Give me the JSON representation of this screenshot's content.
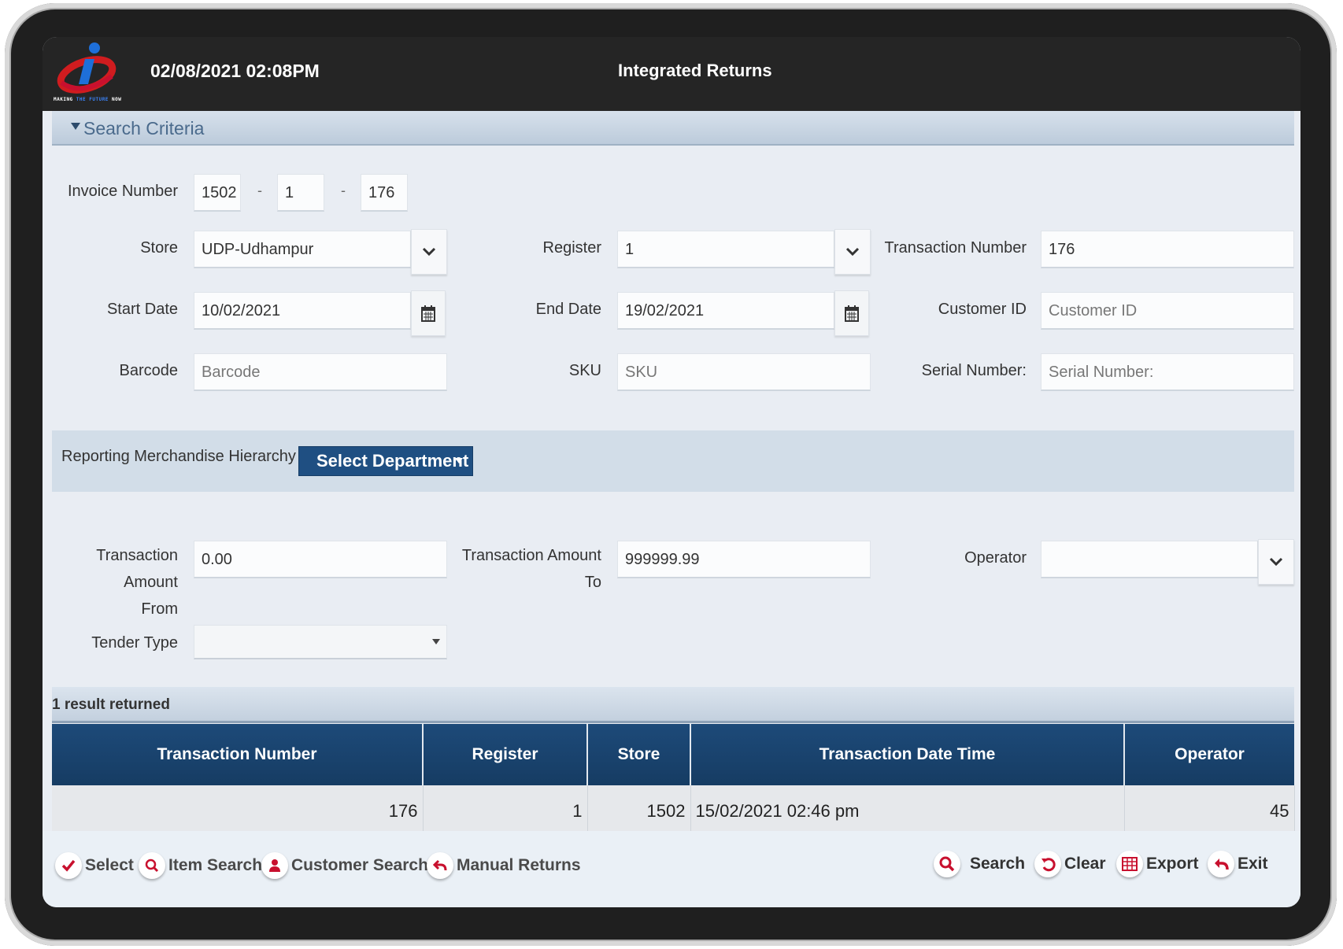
{
  "header": {
    "datetime": "02/08/2021 02:08PM",
    "title": "Integrated Returns",
    "logo_tag_a": "MAKING ",
    "logo_tag_b": "THE FUTURE ",
    "logo_tag_c": "NOW"
  },
  "criteria": {
    "section_title": "Search Criteria",
    "invoice": {
      "label": "Invoice Number",
      "part1": "1502",
      "part2": "1",
      "part3": "176",
      "separator": "-"
    },
    "store": {
      "label": "Store",
      "value": "UDP-Udhampur"
    },
    "register": {
      "label": "Register",
      "value": "1"
    },
    "transaction_number": {
      "label": "Transaction Number",
      "value": "176"
    },
    "start_date": {
      "label": "Start Date",
      "value": "10/02/2021"
    },
    "end_date": {
      "label": "End Date",
      "value": "19/02/2021"
    },
    "customer_id": {
      "label": "Customer ID",
      "placeholder": "Customer ID"
    },
    "barcode": {
      "label": "Barcode",
      "placeholder": "Barcode"
    },
    "sku": {
      "label": "SKU",
      "placeholder": "SKU"
    },
    "serial_number": {
      "label": "Serial Number:",
      "placeholder": "Serial Number:"
    },
    "hierarchy": {
      "label": "Reporting Merchandise Hierarchy",
      "button": "Select Department"
    },
    "amount_from": {
      "label_line1": "Transaction Amount",
      "label_line2": "From",
      "value": "0.00"
    },
    "amount_to": {
      "label_line1": "Transaction Amount",
      "label_line2": "To",
      "value": "999999.99"
    },
    "operator": {
      "label": "Operator",
      "value": ""
    },
    "tender_type": {
      "label": "Tender Type",
      "value": ""
    }
  },
  "results": {
    "summary": "1 result returned",
    "columns": [
      "Transaction Number",
      "Register",
      "Store",
      "Transaction Date Time",
      "Operator"
    ],
    "rows": [
      {
        "transaction_number": "176",
        "register": "1",
        "store": "1502",
        "datetime": "15/02/2021 02:46 pm",
        "operator": "45"
      }
    ]
  },
  "toolbar": {
    "select": "Select",
    "item_search": "Item Search",
    "customer_search": "Customer Search",
    "manual_returns": "Manual Returns",
    "search": "Search",
    "clear": "Clear",
    "export": "Export",
    "exit": "Exit"
  },
  "colors": {
    "header_bg": "#252525",
    "accent_blue": "#1f4f82",
    "icon_red": "#c8102e"
  }
}
